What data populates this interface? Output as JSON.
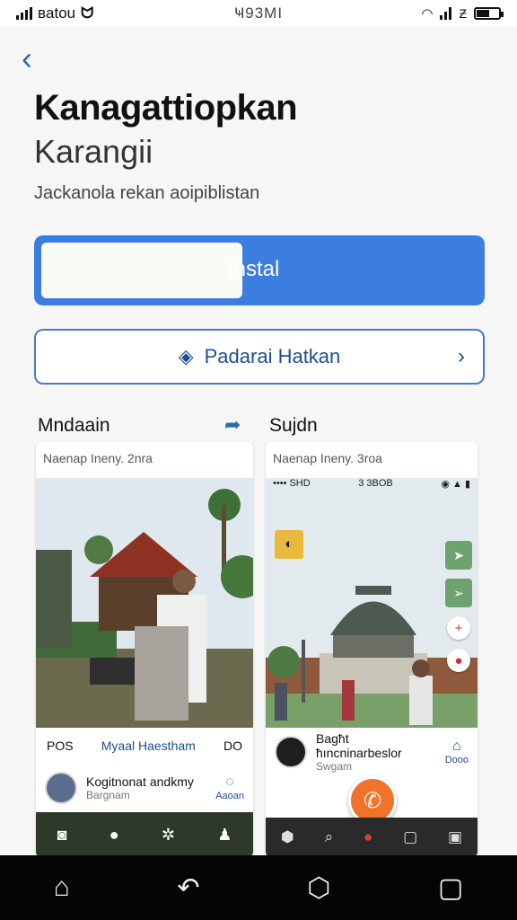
{
  "status_bar": {
    "carrier": "вatou",
    "time": "Ҹ93МI",
    "battery_text": "Ƶ"
  },
  "header": {
    "title": "Kanagattiopkan",
    "subtitle": "Karangii",
    "description": "Jackanola rekan aoipiblistan"
  },
  "install_button": {
    "label": "Instal"
  },
  "secondary_button": {
    "label": "Padarai Hatkan"
  },
  "screenshots": [
    {
      "heading": "Mndaain",
      "caption": "Naenap Ineny. 2nra",
      "footer_left": "POS",
      "footer_link": "Myaal Haestham",
      "footer_right": "DO",
      "comment_title": "Kogitnonat andkmy",
      "comment_sub": "Bargnam",
      "reply_label": "Aaoan"
    },
    {
      "heading": "Sujdn",
      "caption": "Naenap Ineny. 3roa",
      "inner_left": "•••• SHD",
      "inner_center": "3 3BOB",
      "comment_title": "Bagħt ħıncninarbeslor",
      "comment_sub": "Swgam",
      "reply_label": "Dooo"
    }
  ],
  "colors": {
    "accent": "#3b7ee0",
    "link": "#1f4d91",
    "fab": "#f0732a"
  }
}
